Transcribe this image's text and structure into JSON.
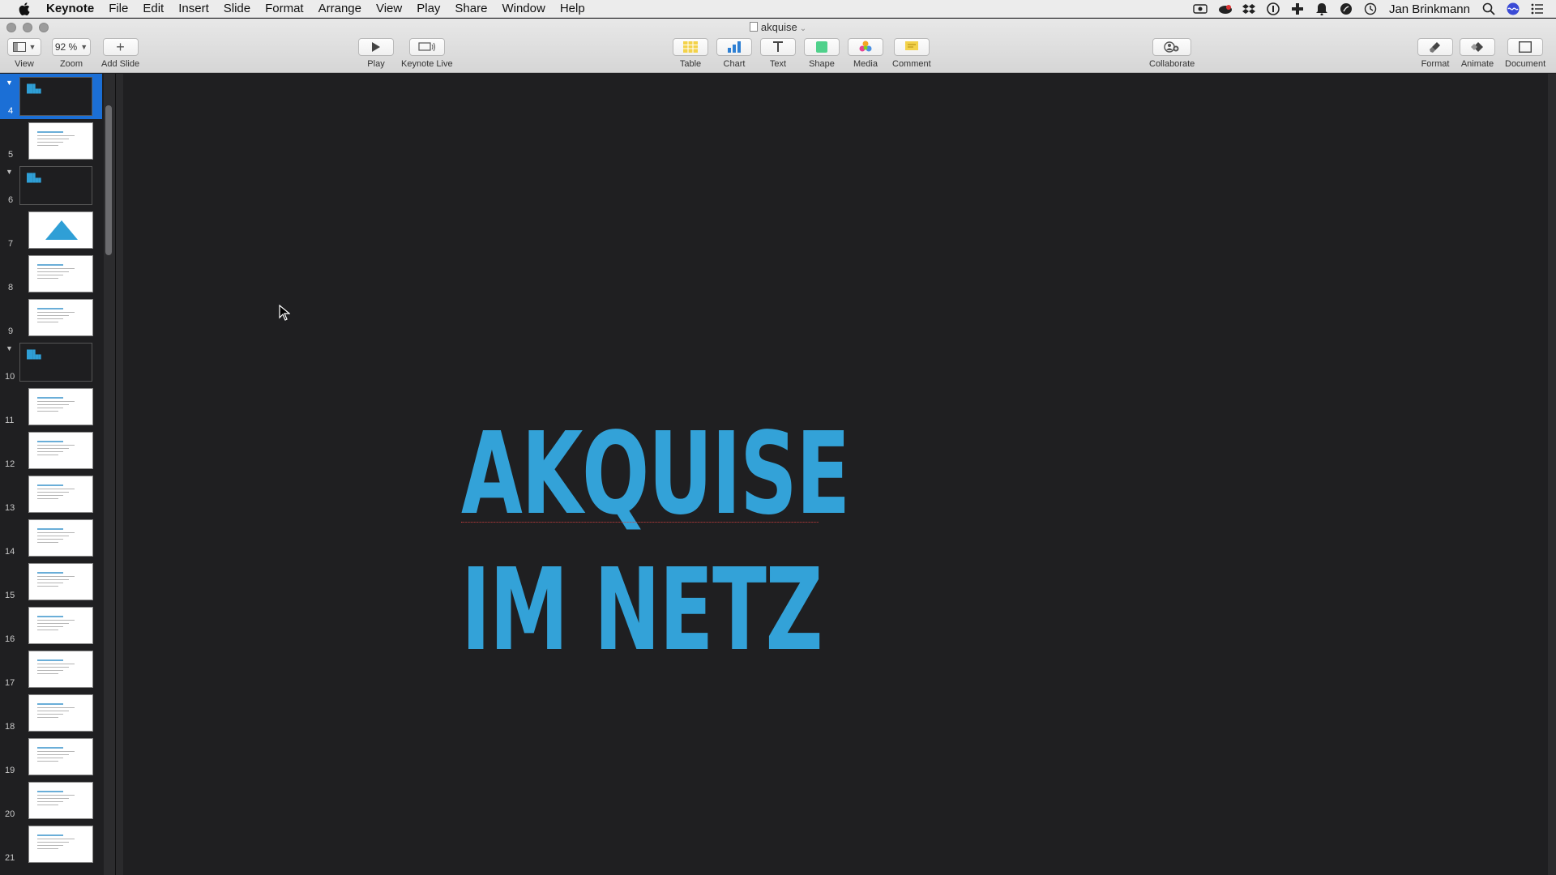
{
  "menubar": {
    "app": "Keynote",
    "items": [
      "File",
      "Edit",
      "Insert",
      "Slide",
      "Format",
      "Arrange",
      "View",
      "Play",
      "Share",
      "Window",
      "Help"
    ],
    "user": "Jan Brinkmann"
  },
  "window": {
    "title": "akquise"
  },
  "toolbar": {
    "view": "View",
    "zoom_value": "92 %",
    "zoom": "Zoom",
    "add_slide": "Add Slide",
    "play": "Play",
    "keynote_live": "Keynote Live",
    "table": "Table",
    "chart": "Chart",
    "text": "Text",
    "shape": "Shape",
    "media": "Media",
    "comment": "Comment",
    "collaborate": "Collaborate",
    "format": "Format",
    "animate": "Animate",
    "document": "Document"
  },
  "navigator": {
    "slides": [
      {
        "num": "4",
        "dark": true,
        "selected": true,
        "group": true
      },
      {
        "num": "5"
      },
      {
        "num": "6",
        "dark": true,
        "group": true
      },
      {
        "num": "7",
        "triangle": true
      },
      {
        "num": "8"
      },
      {
        "num": "9"
      },
      {
        "num": "10",
        "dark": true,
        "group": true
      },
      {
        "num": "11"
      },
      {
        "num": "12"
      },
      {
        "num": "13"
      },
      {
        "num": "14"
      },
      {
        "num": "15"
      },
      {
        "num": "16"
      },
      {
        "num": "17"
      },
      {
        "num": "18"
      },
      {
        "num": "19"
      },
      {
        "num": "20"
      },
      {
        "num": "21"
      }
    ]
  },
  "slide": {
    "line1": "AKQUISE",
    "line2": "IM NETZ"
  },
  "colors": {
    "accent": "#33a2d8",
    "selection": "#1b6fd6",
    "canvas": "#1f1f21"
  }
}
